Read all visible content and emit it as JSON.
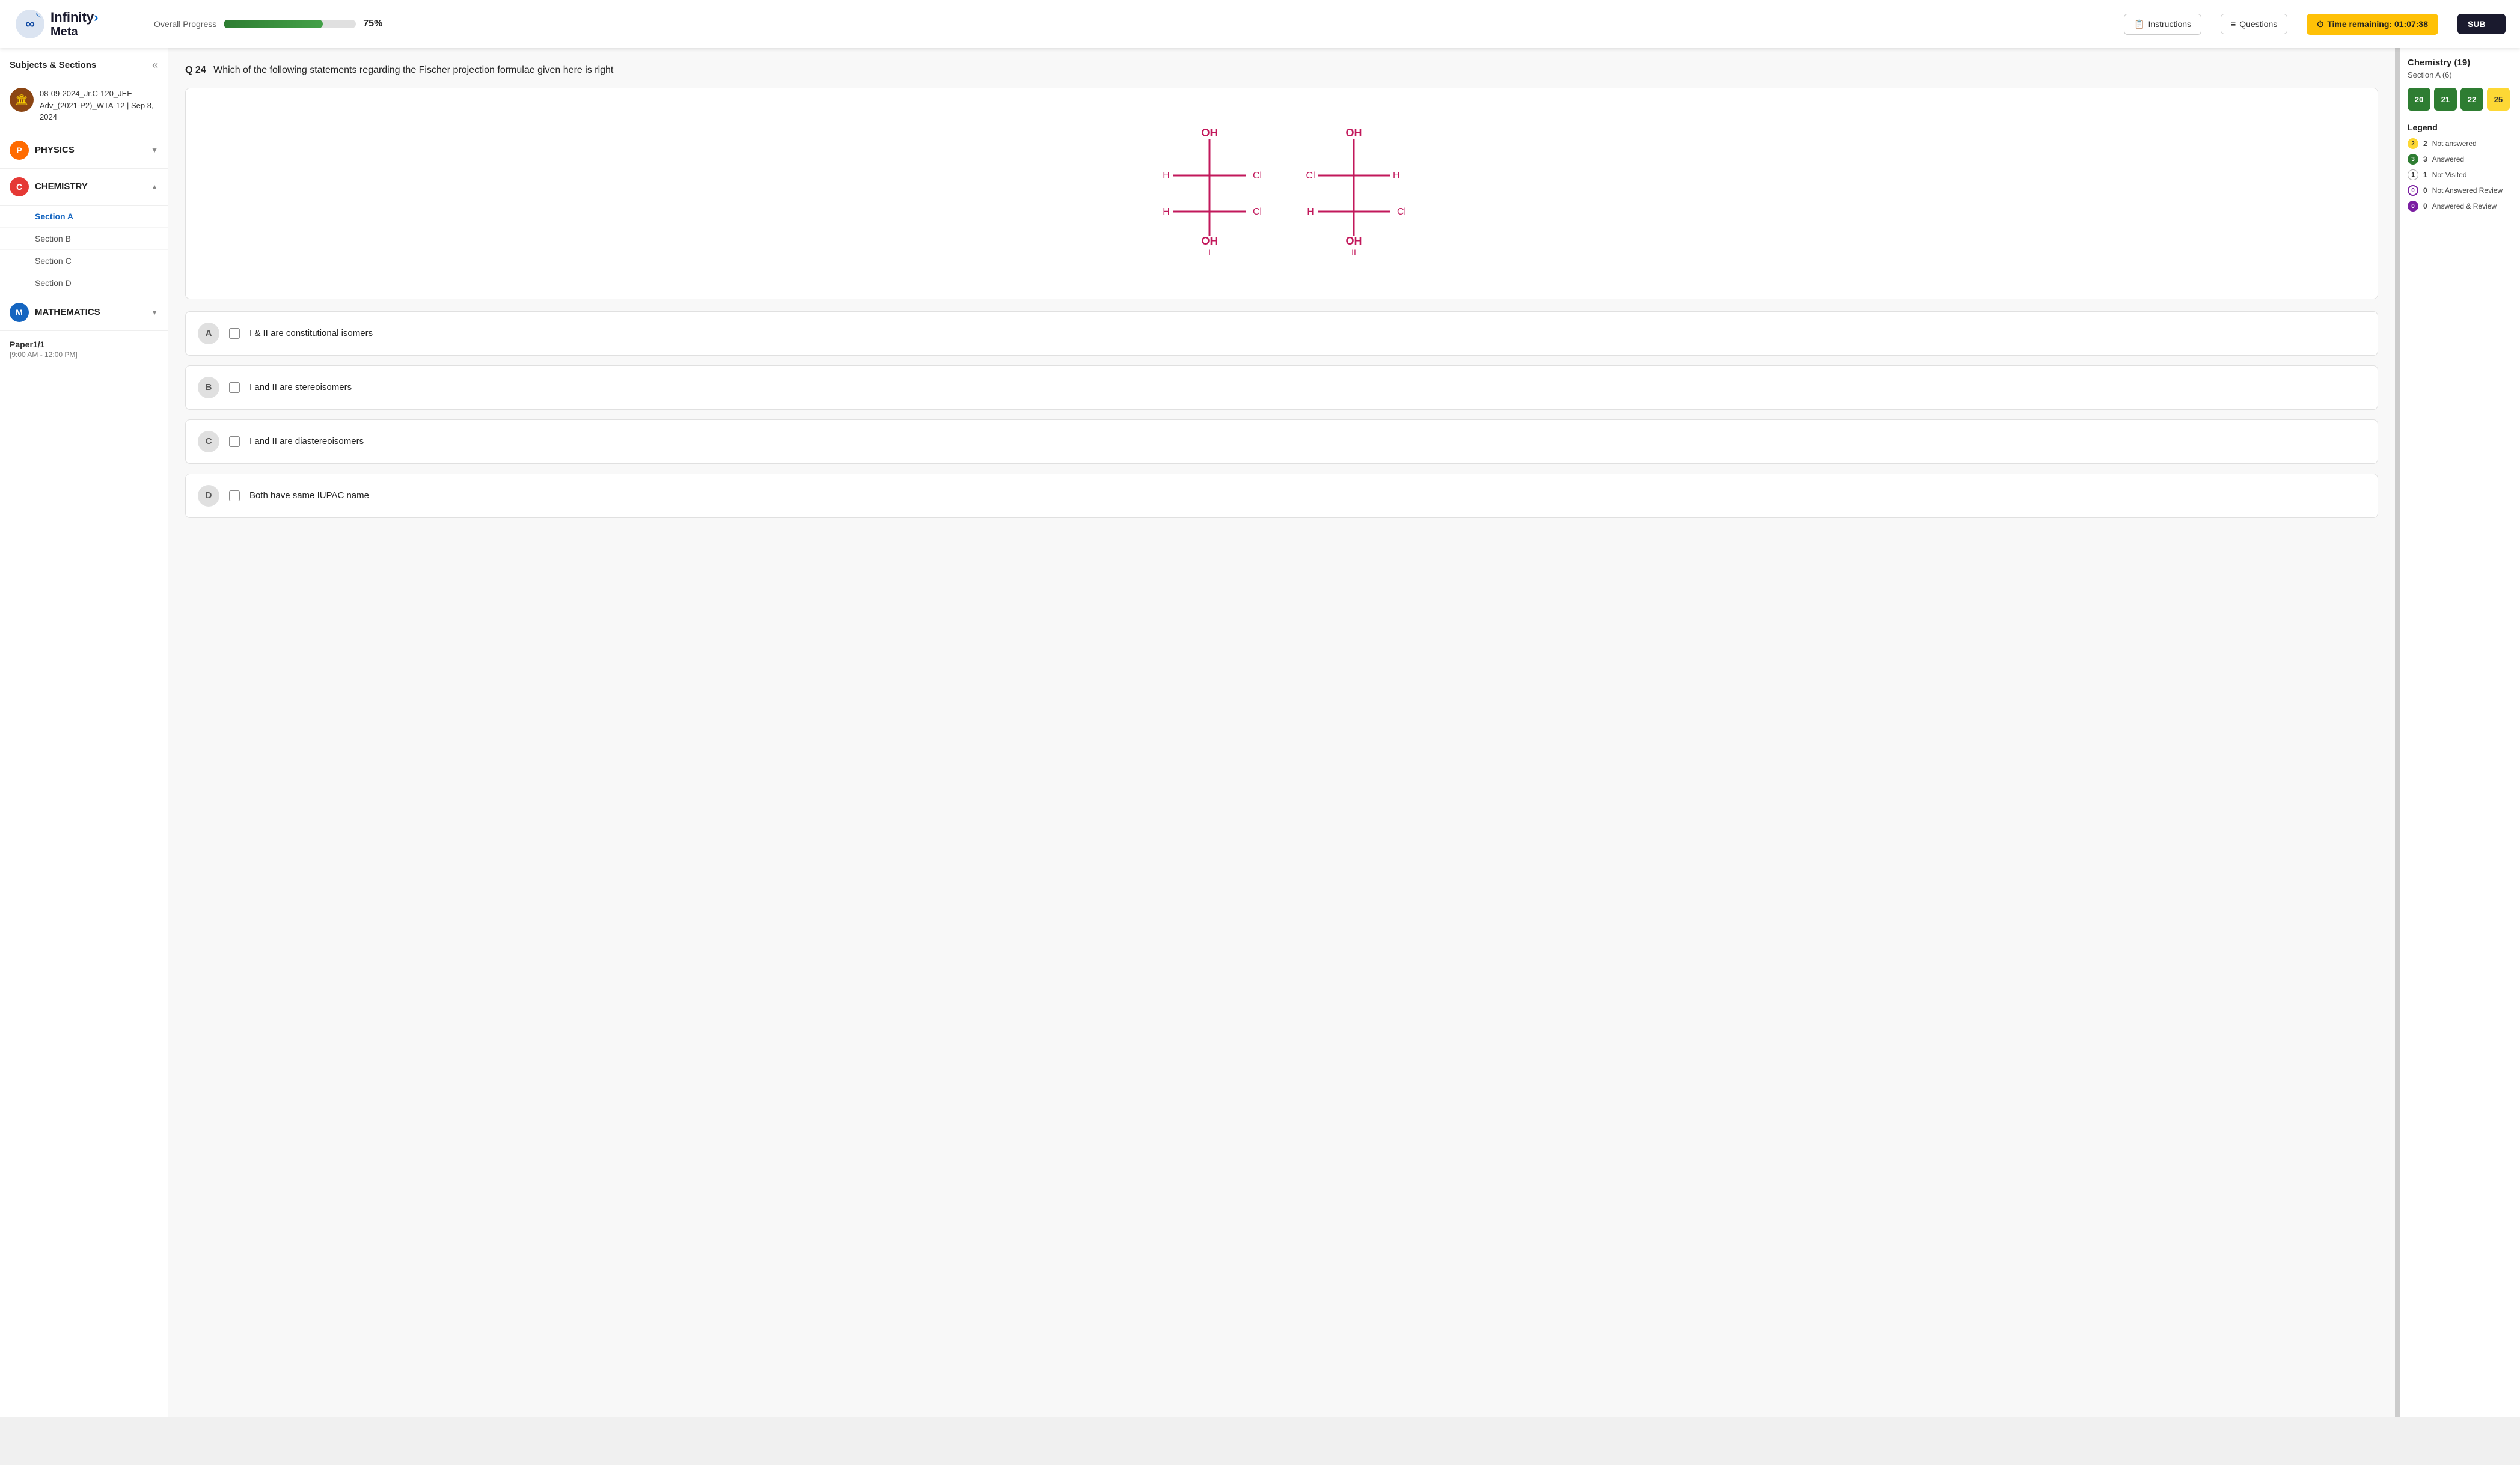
{
  "header": {
    "logo_line1": "Infinity",
    "logo_line2": "Meta",
    "progress_label": "Overall Progress",
    "progress_percent": "75%",
    "instructions_label": "Instructions",
    "questions_label": "Questions",
    "time_label": "Time remaining: 01:07:38",
    "submit_label": "SUB"
  },
  "sidebar": {
    "title": "Subjects & Sections",
    "exam_name": "08-09-2024_Jr.C-120_JEE Adv_(2021-P2)_WTA-12 | Sep 8, 2024",
    "subjects": [
      {
        "id": "physics",
        "label": "PHYSICS",
        "icon": "P",
        "color": "physics",
        "expanded": false
      },
      {
        "id": "chemistry",
        "label": "CHEMISTRY",
        "icon": "C",
        "color": "chemistry",
        "expanded": true
      },
      {
        "id": "mathematics",
        "label": "MATHEMATICS",
        "icon": "M",
        "color": "math",
        "expanded": false
      }
    ],
    "chemistry_sections": [
      {
        "id": "section-a",
        "label": "Section A",
        "active": true
      },
      {
        "id": "section-b",
        "label": "Section B",
        "active": false
      },
      {
        "id": "section-c",
        "label": "Section C",
        "active": false
      },
      {
        "id": "section-d",
        "label": "Section D",
        "active": false
      }
    ],
    "paper_title": "Paper1/1",
    "paper_time": "[9:00 AM - 12:00 PM]"
  },
  "question": {
    "number": "Q 24",
    "text": "Which of the following statements regarding the Fischer projection formulae given here is right",
    "options": [
      {
        "id": "A",
        "text": "I & II are constitutional isomers"
      },
      {
        "id": "B",
        "text": "I and II are stereoisomers"
      },
      {
        "id": "C",
        "text": "I and II are diastereoisomers"
      },
      {
        "id": "D",
        "text": "Both have same IUPAC name"
      }
    ]
  },
  "right_panel": {
    "title": "Chemistry (19)",
    "subtitle": "Section A (6)",
    "question_buttons": [
      {
        "num": "20",
        "status": "answered"
      },
      {
        "num": "21",
        "status": "answered"
      },
      {
        "num": "22",
        "status": "answered"
      },
      {
        "num": "25",
        "status": "not-answered"
      }
    ],
    "legend_title": "Legend",
    "legend_items": [
      {
        "color": "yellow",
        "count": "2",
        "label": "Not answered"
      },
      {
        "color": "green",
        "count": "3",
        "label": "Answered"
      },
      {
        "color": "white",
        "count": "1",
        "label": "Not Visited"
      },
      {
        "color": "purple-outline",
        "count": "0",
        "label": "Not Answered Review"
      },
      {
        "color": "purple-filled",
        "count": "0",
        "label": "Answered & Review"
      }
    ]
  }
}
